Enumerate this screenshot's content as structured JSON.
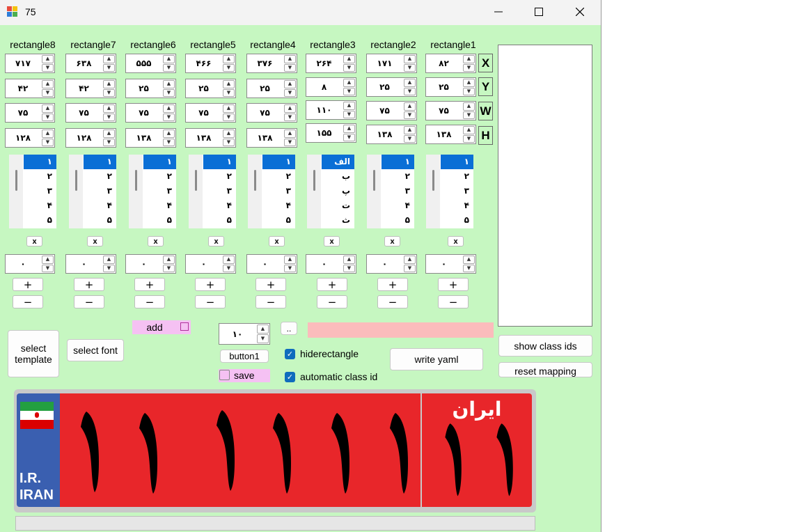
{
  "window": {
    "title": "75"
  },
  "columns": [
    {
      "label": "rectangle8",
      "x": "۷۱۷",
      "y": "۴۲",
      "w": "۷۵",
      "h": "۱۲۸",
      "list": [
        "۱",
        "۲",
        "۳",
        "۴",
        "۵"
      ],
      "count": "۰",
      "x_label": "x",
      "plus": "+",
      "minus": "−"
    },
    {
      "label": "rectangle7",
      "x": "۶۳۸",
      "y": "۴۲",
      "w": "۷۵",
      "h": "۱۲۸",
      "list": [
        "۱",
        "۲",
        "۳",
        "۴",
        "۵"
      ],
      "count": "۰",
      "x_label": "x",
      "plus": "+",
      "minus": "−"
    },
    {
      "label": "rectangle6",
      "x": "۵۵۵",
      "y": "۲۵",
      "w": "۷۵",
      "h": "۱۳۸",
      "list": [
        "۱",
        "۲",
        "۳",
        "۴",
        "۵"
      ],
      "count": "۰",
      "x_label": "x",
      "plus": "+",
      "minus": "−"
    },
    {
      "label": "rectangle5",
      "x": "۴۶۶",
      "y": "۲۵",
      "w": "۷۵",
      "h": "۱۳۸",
      "list": [
        "۱",
        "۲",
        "۳",
        "۴",
        "۵"
      ],
      "count": "۰",
      "x_label": "x",
      "plus": "+",
      "minus": "−"
    },
    {
      "label": "rectangle4",
      "x": "۳۷۶",
      "y": "۲۵",
      "w": "۷۵",
      "h": "۱۳۸",
      "list": [
        "۱",
        "۲",
        "۳",
        "۴",
        "۵"
      ],
      "count": "۰",
      "x_label": "x",
      "plus": "+",
      "minus": "−"
    },
    {
      "label": "rectangle3",
      "x": "۲۶۴",
      "y": "۸",
      "w": "۱۱۰",
      "h": "۱۵۵",
      "list": [
        "الف",
        "ب",
        "پ",
        "ت",
        "ث"
      ],
      "count": "۰",
      "x_label": "x",
      "plus": "+",
      "minus": "−"
    },
    {
      "label": "rectangle2",
      "x": "۱۷۱",
      "y": "۲۵",
      "w": "۷۵",
      "h": "۱۳۸",
      "list": [
        "۱",
        "۲",
        "۳",
        "۴",
        "۵"
      ],
      "count": "۰",
      "x_label": "x",
      "plus": "+",
      "minus": "−"
    },
    {
      "label": "rectangle1",
      "x": "۸۲",
      "y": "۲۵",
      "w": "۷۵",
      "h": "۱۳۸",
      "list": [
        "۱",
        "۲",
        "۳",
        "۴",
        "۵"
      ],
      "count": "۰",
      "x_label": "x",
      "plus": "+",
      "minus": "−"
    }
  ],
  "axis_labels": {
    "x": "X",
    "y": "Y",
    "w": "W",
    "h": "H"
  },
  "buttons": {
    "select_template": "select template",
    "select_font": "select font",
    "add": "add",
    "button1": "button1",
    "save": "save",
    "browse": "..",
    "write_yaml": "write yaml",
    "show_class_ids": "show class ids",
    "reset_mapping": "reset mapping"
  },
  "font_size": "۱۰",
  "checkboxes": {
    "hiderectangle": {
      "label": "hiderectangle",
      "checked": true
    },
    "automatic_class_id": {
      "label": "automatic class id",
      "checked": true
    }
  },
  "plate": {
    "country_code": "I.R.",
    "country": "IRAN",
    "region_word": "ایران"
  },
  "colors": {
    "background": "#c6f7c1",
    "accent": "#0f6cbd",
    "pink": "#f5c1f3",
    "path_field": "#fbbcbc",
    "plate_red": "#e8262a",
    "plate_blue": "#3a5fb0"
  }
}
